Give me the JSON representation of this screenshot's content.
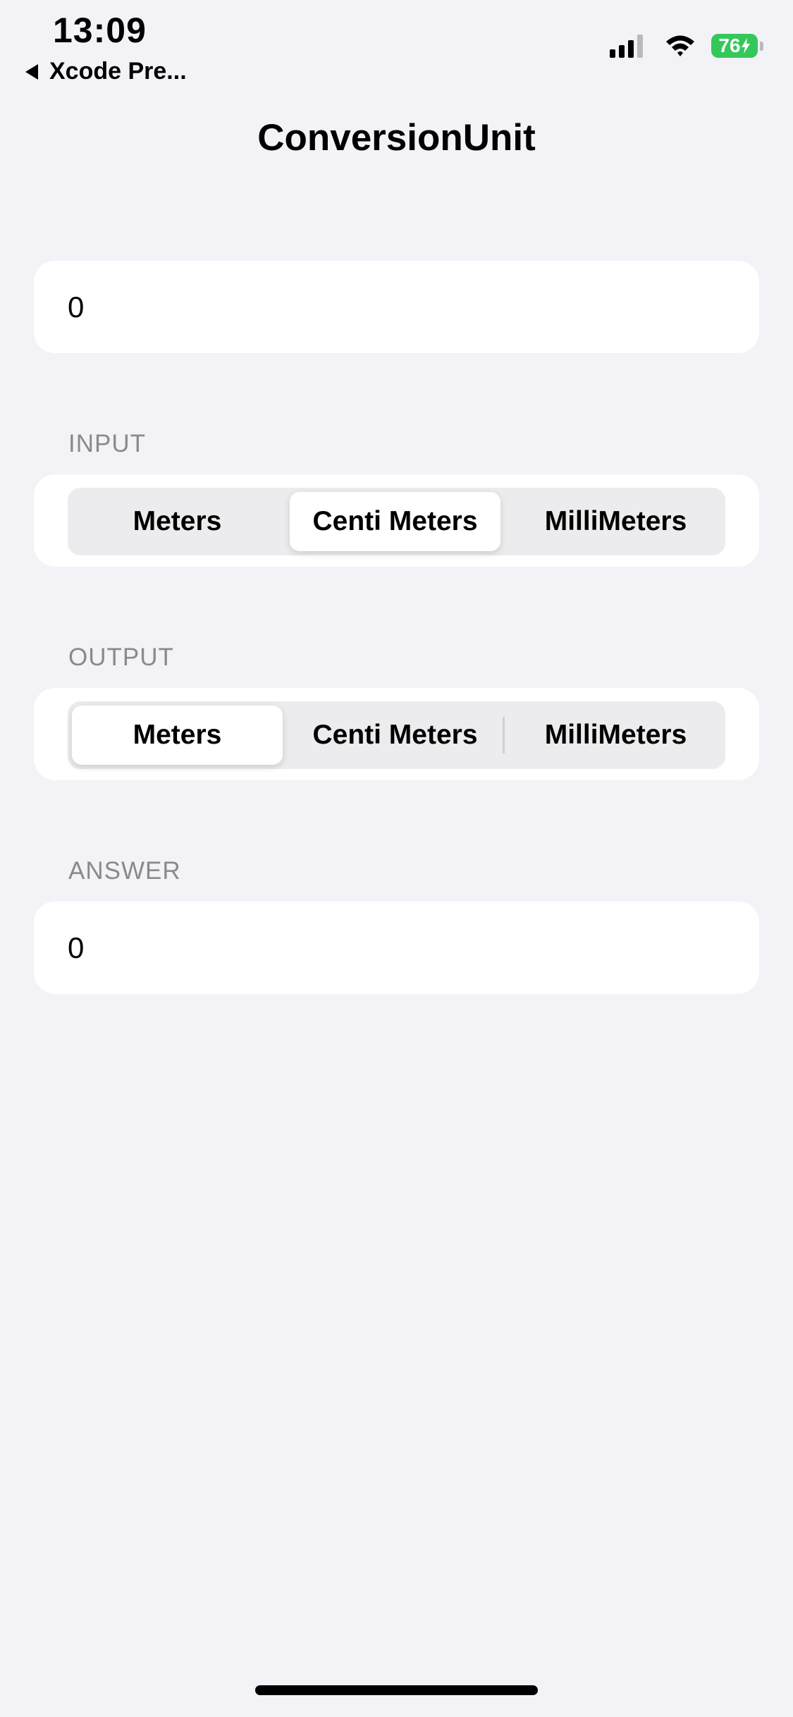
{
  "status_bar": {
    "time": "13:09",
    "back_label": "Xcode Pre...",
    "battery_level": "76",
    "battery_color": "#34c759",
    "charging": true
  },
  "nav": {
    "title": "ConversionUnit"
  },
  "input_field": {
    "value": "0"
  },
  "input_section": {
    "label": "INPUT",
    "options": [
      "Meters",
      "Centi Meters",
      "MilliMeters"
    ],
    "selected": "Centi Meters"
  },
  "output_section": {
    "label": "OUTPUT",
    "options": [
      "Meters",
      "Centi Meters",
      "MilliMeters"
    ],
    "selected": "Meters"
  },
  "answer_section": {
    "label": "ANSWER",
    "value": "0"
  }
}
